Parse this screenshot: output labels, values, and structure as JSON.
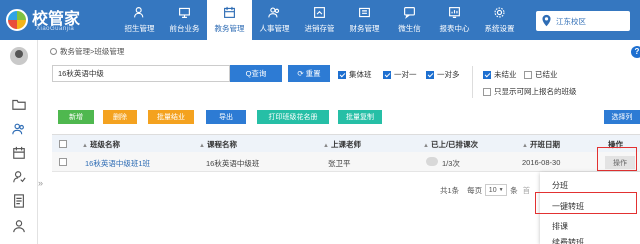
{
  "app": {
    "name": "校管家",
    "subtitle": "XiaoGuanjia"
  },
  "nav": {
    "items": [
      {
        "label": "招生管理",
        "icon": "user-add-icon"
      },
      {
        "label": "前台业务",
        "icon": "desk-icon"
      },
      {
        "label": "教务管理",
        "icon": "calendar-icon",
        "active": true
      },
      {
        "label": "人事管理",
        "icon": "people-icon"
      },
      {
        "label": "进销存管",
        "icon": "box-icon"
      },
      {
        "label": "财务管理",
        "icon": "money-icon"
      },
      {
        "label": "微生信",
        "icon": "chat-icon"
      },
      {
        "label": "报表中心",
        "icon": "chart-icon"
      },
      {
        "label": "系统设置",
        "icon": "gear-icon"
      }
    ],
    "campus": "江东校区"
  },
  "breadcrumb": "教务管理>班级管理",
  "help": "?",
  "search": {
    "value": "16秋英语中级",
    "query_label": "Q查询",
    "reset_label": "重置"
  },
  "filters": [
    {
      "label": "集体班",
      "checked": true
    },
    {
      "label": "一对一",
      "checked": true
    },
    {
      "label": "一对多",
      "checked": true
    },
    {
      "label": "未结业",
      "checked": true
    },
    {
      "label": "已结业",
      "checked": false
    },
    {
      "label": "只显示可网上报名的班级",
      "checked": false
    }
  ],
  "actions": [
    {
      "label": "新增",
      "color": "#4fb84f"
    },
    {
      "label": "删除",
      "color": "#f4a21f"
    },
    {
      "label": "批量结业",
      "color": "#f4a21f"
    },
    {
      "label": "导出",
      "color": "#2d7bd4"
    },
    {
      "label": "打印班级花名册",
      "color": "#26bfa6"
    },
    {
      "label": "批量复制",
      "color": "#26bfa6"
    },
    {
      "label": "选择列",
      "color": "#2d7bd4"
    }
  ],
  "table": {
    "headers": [
      "班级名称",
      "课程名称",
      "上课老师",
      "已上/已排课次",
      "开班日期",
      "操作"
    ],
    "rows": [
      {
        "class_name": "16秋英语中级班1班",
        "course": "16秋英语中级班",
        "teacher": "张卫平",
        "sessions": "1/3次",
        "start_date": "2016-08-30",
        "op": "操作"
      }
    ]
  },
  "pager": {
    "total": "共1条",
    "per_page_label": "每页",
    "per_page": "10",
    "unit": "条",
    "nav": "首"
  },
  "menu": [
    "分班",
    "一键转班",
    "排课",
    "续费转班"
  ],
  "colors": {
    "primary": "#3577c0",
    "accent": "#2d7bd4",
    "highlight": "#e23131"
  }
}
